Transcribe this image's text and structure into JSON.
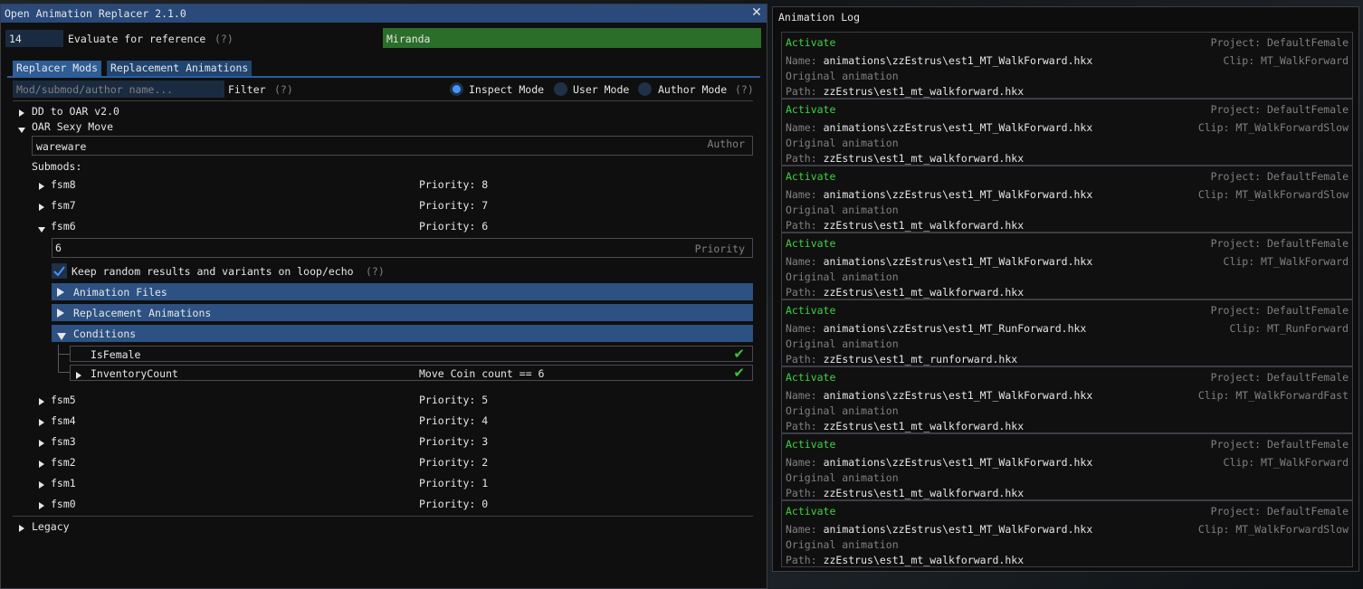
{
  "left_window": {
    "title": "Open Animation Replacer 2.1.0",
    "reference": {
      "value": "14",
      "label": "Evaluate for reference",
      "help": "(?)",
      "target_name": "Miranda"
    },
    "tabs": [
      "Replacer Mods",
      "Replacement Animations"
    ],
    "filter": {
      "placeholder": "Mod/submod/author name...",
      "label": "Filter",
      "help": "(?)"
    },
    "modes": {
      "inspect": "Inspect Mode",
      "user": "User Mode",
      "author": "Author Mode",
      "help": "(?)",
      "selected": "inspect"
    },
    "mods": [
      {
        "name": "DD to OAR v2.0"
      },
      {
        "name": "OAR Sexy Move",
        "author_value": "wareware",
        "author_label": "Author"
      }
    ],
    "submods_label": "Submods:",
    "submods_top": [
      {
        "name": "fsm8",
        "priority": "Priority: 8"
      },
      {
        "name": "fsm7",
        "priority": "Priority: 7"
      },
      {
        "name": "fsm6",
        "priority": "Priority: 6"
      }
    ],
    "expanded": {
      "priority_value": "6",
      "priority_label": "Priority",
      "keep_random_label": "Keep random results and variants on loop/echo",
      "keep_random_help": "(?)",
      "sections": [
        "Animation Files",
        "Replacement Animations",
        "Conditions"
      ],
      "conditions": [
        {
          "name": "IsFemale",
          "desc": ""
        },
        {
          "name": "InventoryCount",
          "desc": "Move Coin count == 6"
        }
      ]
    },
    "submods_bottom": [
      {
        "name": "fsm5",
        "priority": "Priority: 5"
      },
      {
        "name": "fsm4",
        "priority": "Priority: 4"
      },
      {
        "name": "fsm3",
        "priority": "Priority: 3"
      },
      {
        "name": "fsm2",
        "priority": "Priority: 2"
      },
      {
        "name": "fsm1",
        "priority": "Priority: 1"
      },
      {
        "name": "fsm0",
        "priority": "Priority: 0"
      }
    ],
    "legacy": "Legacy"
  },
  "right_window": {
    "title": "Animation Log",
    "entries": [
      {
        "event": "Activate",
        "project": "Project: DefaultFemale",
        "name_label": "Name:",
        "name": "animations\\zzEstrus\\est1_MT_WalkForward.hkx",
        "clip": "Clip: MT_WalkForward",
        "orig": "Original animation",
        "path_label": "Path:",
        "path": "zzEstrus\\est1_mt_walkforward.hkx"
      },
      {
        "event": "Activate",
        "project": "Project: DefaultFemale",
        "name_label": "Name:",
        "name": "animations\\zzEstrus\\est1_MT_WalkForward.hkx",
        "clip": "Clip: MT_WalkForwardSlow",
        "orig": "Original animation",
        "path_label": "Path:",
        "path": "zzEstrus\\est1_mt_walkforward.hkx"
      },
      {
        "event": "Activate",
        "project": "Project: DefaultFemale",
        "name_label": "Name:",
        "name": "animations\\zzEstrus\\est1_MT_WalkForward.hkx",
        "clip": "Clip: MT_WalkForwardSlow",
        "orig": "Original animation",
        "path_label": "Path:",
        "path": "zzEstrus\\est1_mt_walkforward.hkx"
      },
      {
        "event": "Activate",
        "project": "Project: DefaultFemale",
        "name_label": "Name:",
        "name": "animations\\zzEstrus\\est1_MT_WalkForward.hkx",
        "clip": "Clip: MT_WalkForward",
        "orig": "Original animation",
        "path_label": "Path:",
        "path": "zzEstrus\\est1_mt_walkforward.hkx"
      },
      {
        "event": "Activate",
        "project": "Project: DefaultFemale",
        "name_label": "Name:",
        "name": "animations\\zzEstrus\\est1_MT_RunForward.hkx",
        "clip": "Clip: MT_RunForward",
        "orig": "Original animation",
        "path_label": "Path:",
        "path": "zzEstrus\\est1_mt_runforward.hkx"
      },
      {
        "event": "Activate",
        "project": "Project: DefaultFemale",
        "name_label": "Name:",
        "name": "animations\\zzEstrus\\est1_MT_WalkForward.hkx",
        "clip": "Clip: MT_WalkForwardFast",
        "orig": "Original animation",
        "path_label": "Path:",
        "path": "zzEstrus\\est1_mt_walkforward.hkx"
      },
      {
        "event": "Activate",
        "project": "Project: DefaultFemale",
        "name_label": "Name:",
        "name": "animations\\zzEstrus\\est1_MT_WalkForward.hkx",
        "clip": "Clip: MT_WalkForward",
        "orig": "Original animation",
        "path_label": "Path:",
        "path": "zzEstrus\\est1_mt_walkforward.hkx"
      },
      {
        "event": "Activate",
        "project": "Project: DefaultFemale",
        "name_label": "Name:",
        "name": "animations\\zzEstrus\\est1_MT_WalkForward.hkx",
        "clip": "Clip: MT_WalkForwardSlow",
        "orig": "Original animation",
        "path_label": "Path:",
        "path": "zzEstrus\\est1_mt_walkforward.hkx"
      }
    ]
  },
  "colors": {
    "accent": "#4296fa",
    "title_bar": "#294a7a",
    "header": "#2c5182",
    "activate": "#3fd23f",
    "reference_field": "#2a6e29"
  }
}
